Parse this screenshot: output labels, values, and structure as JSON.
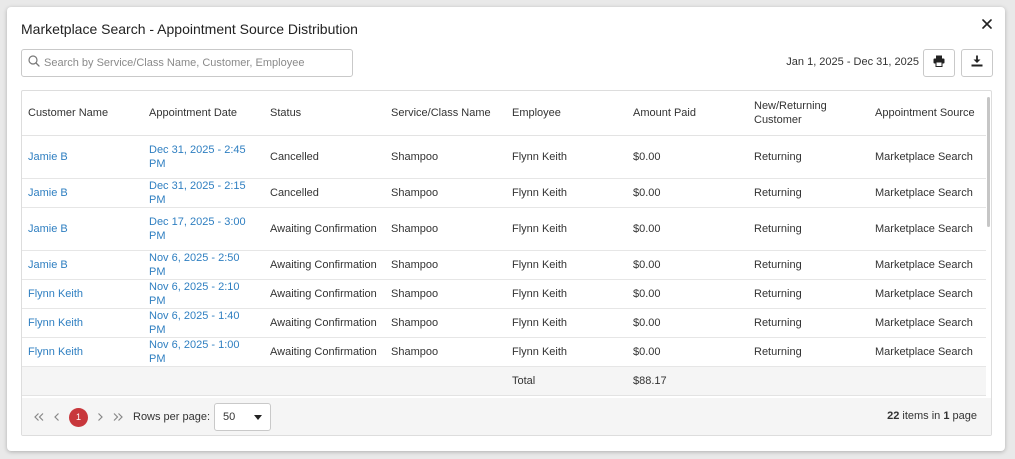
{
  "dialog": {
    "title": "Marketplace Search - Appointment Source Distribution",
    "close_icon": "close-icon"
  },
  "toolbar": {
    "search_placeholder": "Search by Service/Class Name, Customer, Employee",
    "search_value": "",
    "date_range": "Jan 1, 2025 - Dec 31, 2025",
    "print_icon": "printer-icon",
    "download_icon": "download-icon"
  },
  "table": {
    "columns": [
      "Customer Name",
      "Appointment Date",
      "Status",
      "Service/Class Name",
      "Employee",
      "Amount Paid",
      "New/Returning Customer",
      "Appointment Source"
    ],
    "rows": [
      {
        "customer": "Jamie B",
        "date": "Dec 31, 2025 - 2:45 PM",
        "status": "Cancelled",
        "service": "Shampoo",
        "employee": "Flynn Keith",
        "amount": "$0.00",
        "type": "Returning",
        "source": "Marketplace Search"
      },
      {
        "customer": "Jamie B",
        "date": "Dec 31, 2025 - 2:15 PM",
        "status": "Cancelled",
        "service": "Shampoo",
        "employee": "Flynn Keith",
        "amount": "$0.00",
        "type": "Returning",
        "source": "Marketplace Search"
      },
      {
        "customer": "Jamie B",
        "date": "Dec 17, 2025 - 3:00 PM",
        "status": "Awaiting Confirmation",
        "service": "Shampoo",
        "employee": "Flynn Keith",
        "amount": "$0.00",
        "type": "Returning",
        "source": "Marketplace Search"
      },
      {
        "customer": "Jamie B",
        "date": "Nov 6, 2025 - 2:50 PM",
        "status": "Awaiting Confirmation",
        "service": "Shampoo",
        "employee": "Flynn Keith",
        "amount": "$0.00",
        "type": "Returning",
        "source": "Marketplace Search"
      },
      {
        "customer": "Flynn Keith",
        "date": "Nov 6, 2025 - 2:10 PM",
        "status": "Awaiting Confirmation",
        "service": "Shampoo",
        "employee": "Flynn Keith",
        "amount": "$0.00",
        "type": "Returning",
        "source": "Marketplace Search"
      },
      {
        "customer": "Flynn Keith",
        "date": "Nov 6, 2025 - 1:40 PM",
        "status": "Awaiting Confirmation",
        "service": "Shampoo",
        "employee": "Flynn Keith",
        "amount": "$0.00",
        "type": "Returning",
        "source": "Marketplace Search"
      },
      {
        "customer": "Flynn Keith",
        "date": "Nov 6, 2025 - 1:00 PM",
        "status": "Awaiting Confirmation",
        "service": "Shampoo",
        "employee": "Flynn Keith",
        "amount": "$0.00",
        "type": "Returning",
        "source": "Marketplace Search"
      }
    ],
    "total_label": "Total",
    "total_amount": "$88.17"
  },
  "pager": {
    "current_page": "1",
    "rows_per_page_label": "Rows per page:",
    "rows_per_page_value": "50",
    "items_count": "22",
    "items_in_text": " items in ",
    "page_count": "1",
    "page_text": " page"
  },
  "colors": {
    "link": "#2f7fc1",
    "current_page_badge": "#c8373c"
  }
}
